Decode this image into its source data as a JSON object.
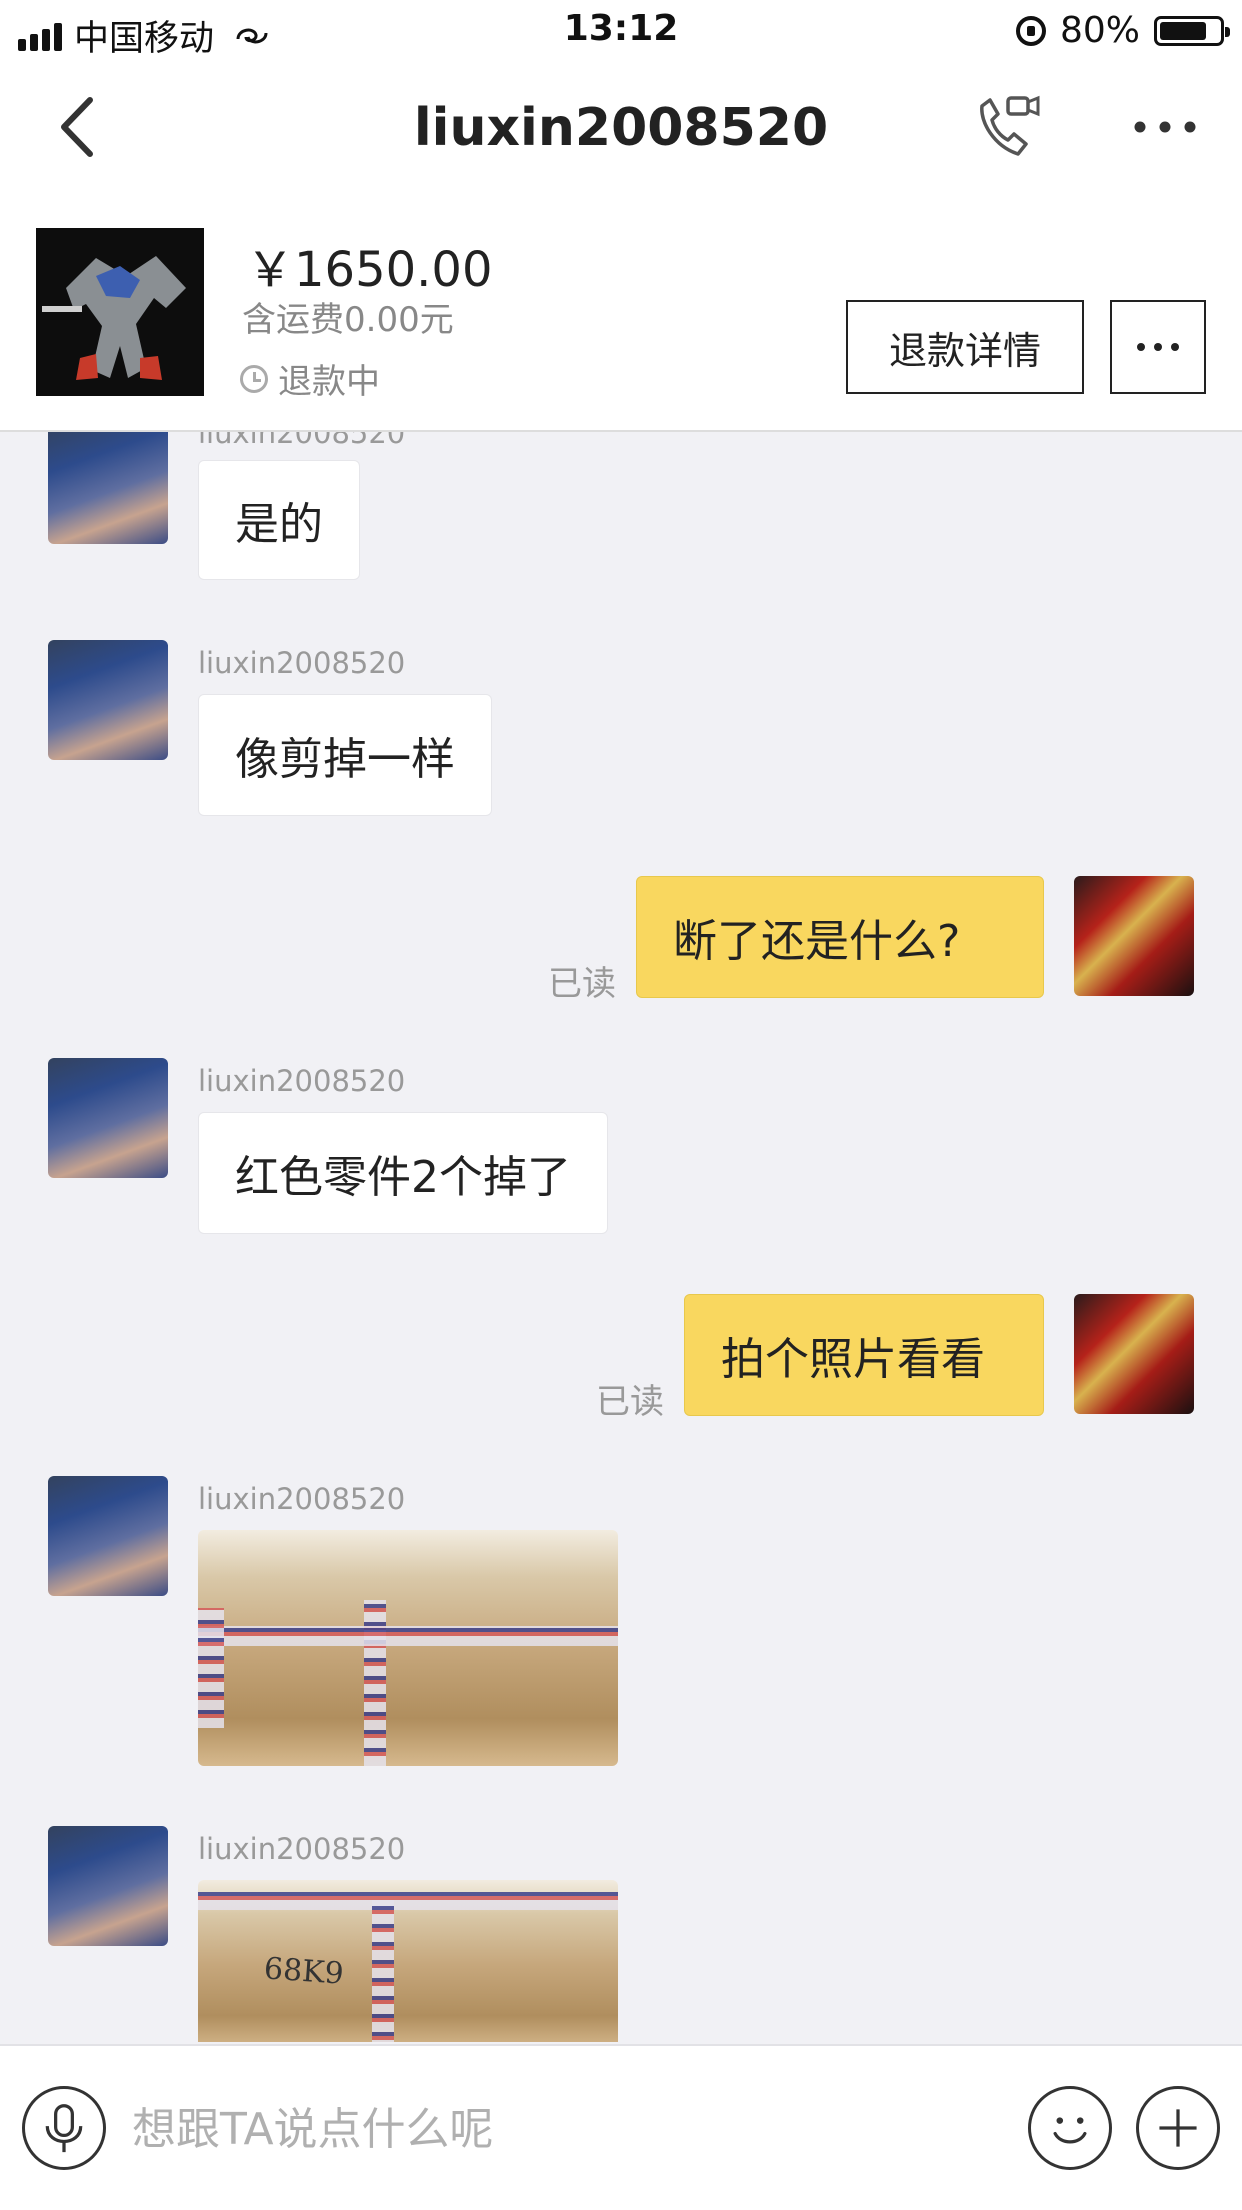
{
  "status_bar": {
    "carrier": "中国移动",
    "time": "13:12",
    "battery": "80%",
    "battery_level": 0.8
  },
  "nav": {
    "title": "liuxin2008520"
  },
  "order": {
    "price": "￥1650.00",
    "shipping": "含运费0.00元",
    "status": "退款中",
    "refund_details_label": "退款详情"
  },
  "chat": {
    "messages": [
      {
        "sender": "liuxin2008520",
        "text": "是的"
      },
      {
        "sender": "liuxin2008520",
        "text": "像剪掉一样"
      },
      {
        "text": "断了还是什么?",
        "status": "已读"
      },
      {
        "sender": "liuxin2008520",
        "text": "红色零件2个掉了"
      },
      {
        "text": "拍个照片看看",
        "status": "已读"
      },
      {
        "sender": "liuxin2008520",
        "image": "package-box-photo"
      },
      {
        "sender": "liuxin2008520",
        "image": "package-box-photo",
        "handwriting": "68K9"
      }
    ]
  },
  "input": {
    "placeholder": "想跟TA说点什么呢"
  },
  "icons": {
    "back": "back-chevron-icon",
    "call": "phone-video-icon",
    "more": "more-dots-icon",
    "voice": "microphone-icon",
    "emoji": "smiley-icon",
    "plus": "plus-icon",
    "clock": "clock-icon"
  }
}
